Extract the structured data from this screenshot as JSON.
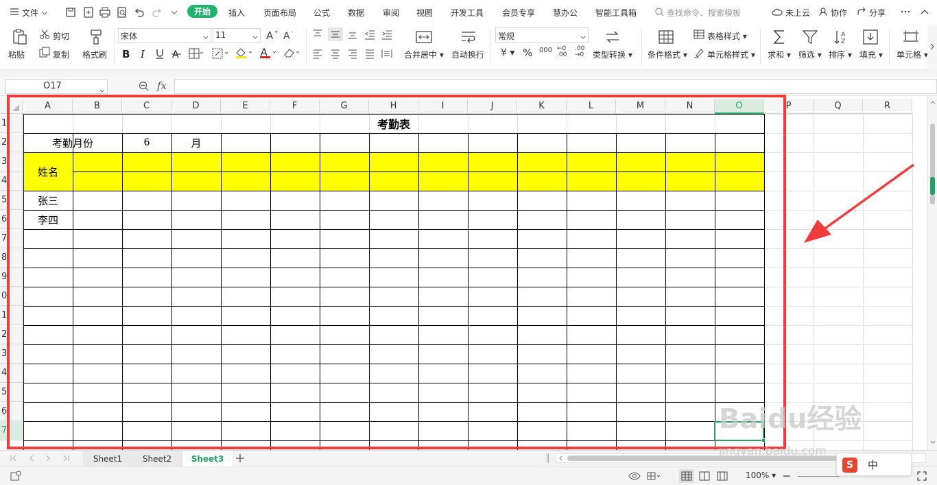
{
  "menu": {
    "file_label": "文件",
    "tabs": [
      "开始",
      "插入",
      "页面布局",
      "公式",
      "数据",
      "审阅",
      "视图",
      "开发工具",
      "会员专享",
      "慧办公",
      "智能工具箱"
    ],
    "active_tab": "开始",
    "search_placeholder": "查找命令、搜索模板",
    "cloud_label": "未上云",
    "collab_label": "协作",
    "share_label": "分享"
  },
  "ribbon": {
    "paste": "粘贴",
    "cut": "剪切",
    "copy": "复制",
    "format_painter": "格式刷",
    "font_name": "宋体",
    "font_size": "11",
    "merge_center": "合并居中",
    "wrap_text": "自动换行",
    "number_format": "常规",
    "type_convert": "类型转换",
    "cond_format": "条件格式",
    "table_style": "表格样式",
    "cell_style": "单元格样式",
    "sum": "求和",
    "filter": "筛选",
    "sort": "排序",
    "fill": "填充",
    "cell": "单元格",
    "currency_symbol": "¥",
    "percent_symbol": "%",
    "thousands_symbol": "000",
    "dec_inc_symbol": "←0 .00",
    "dec_dec_symbol": ".00 →0",
    "font_color": "#e02020",
    "fill_color": "#ffe600"
  },
  "formula_bar": {
    "name_box": "O17",
    "fx_label": "fx",
    "content": ""
  },
  "sheet": {
    "columns": [
      "A",
      "B",
      "C",
      "D",
      "E",
      "F",
      "G",
      "H",
      "I",
      "J",
      "K",
      "L",
      "M",
      "N",
      "O",
      "P",
      "Q",
      "R"
    ],
    "selected_column": "O",
    "rows": [
      "1",
      "2",
      "3",
      "4",
      "5",
      "6",
      "7",
      "8",
      "9",
      "0",
      "1",
      "2",
      "3",
      "4",
      "5",
      "6",
      "7"
    ],
    "selected_row_index": 16,
    "title": "考勤表",
    "month_label": "考勤月份",
    "month_value": "6",
    "month_unit": "月",
    "name_header": "姓名",
    "names": [
      "张三",
      "李四"
    ],
    "highlight_color": "#ffff00"
  },
  "sheet_tabs": {
    "tabs": [
      "Sheet1",
      "Sheet2",
      "Sheet3"
    ],
    "active": "Sheet3",
    "add_label": "+"
  },
  "status": {
    "zoom": "100%",
    "ime_label": "中",
    "ime_logo": "S"
  },
  "watermark": {
    "brand": "Baidu经验",
    "url": "jingyan.baidu.com"
  }
}
